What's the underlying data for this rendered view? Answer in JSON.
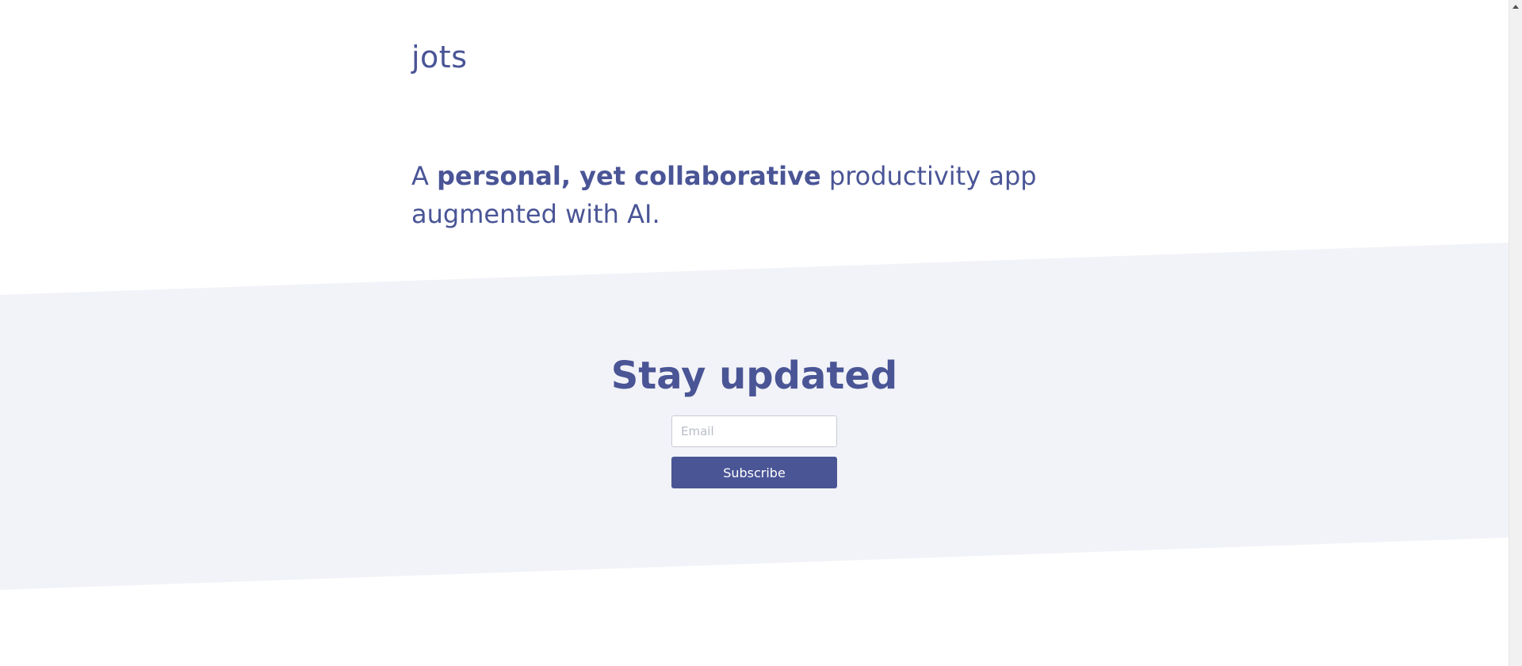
{
  "header": {
    "logo_text": "jots"
  },
  "hero": {
    "tagline_prefix": "A ",
    "tagline_emphasis": "personal, yet collaborative",
    "tagline_suffix": " productivity app augmented with AI."
  },
  "subscribe": {
    "title": "Stay updated",
    "email_placeholder": "Email",
    "email_value": "",
    "button_label": "Subscribe"
  },
  "colors": {
    "brand": "#4a5596",
    "band_background": "#f2f3f8",
    "page_background": "#ffffff"
  }
}
